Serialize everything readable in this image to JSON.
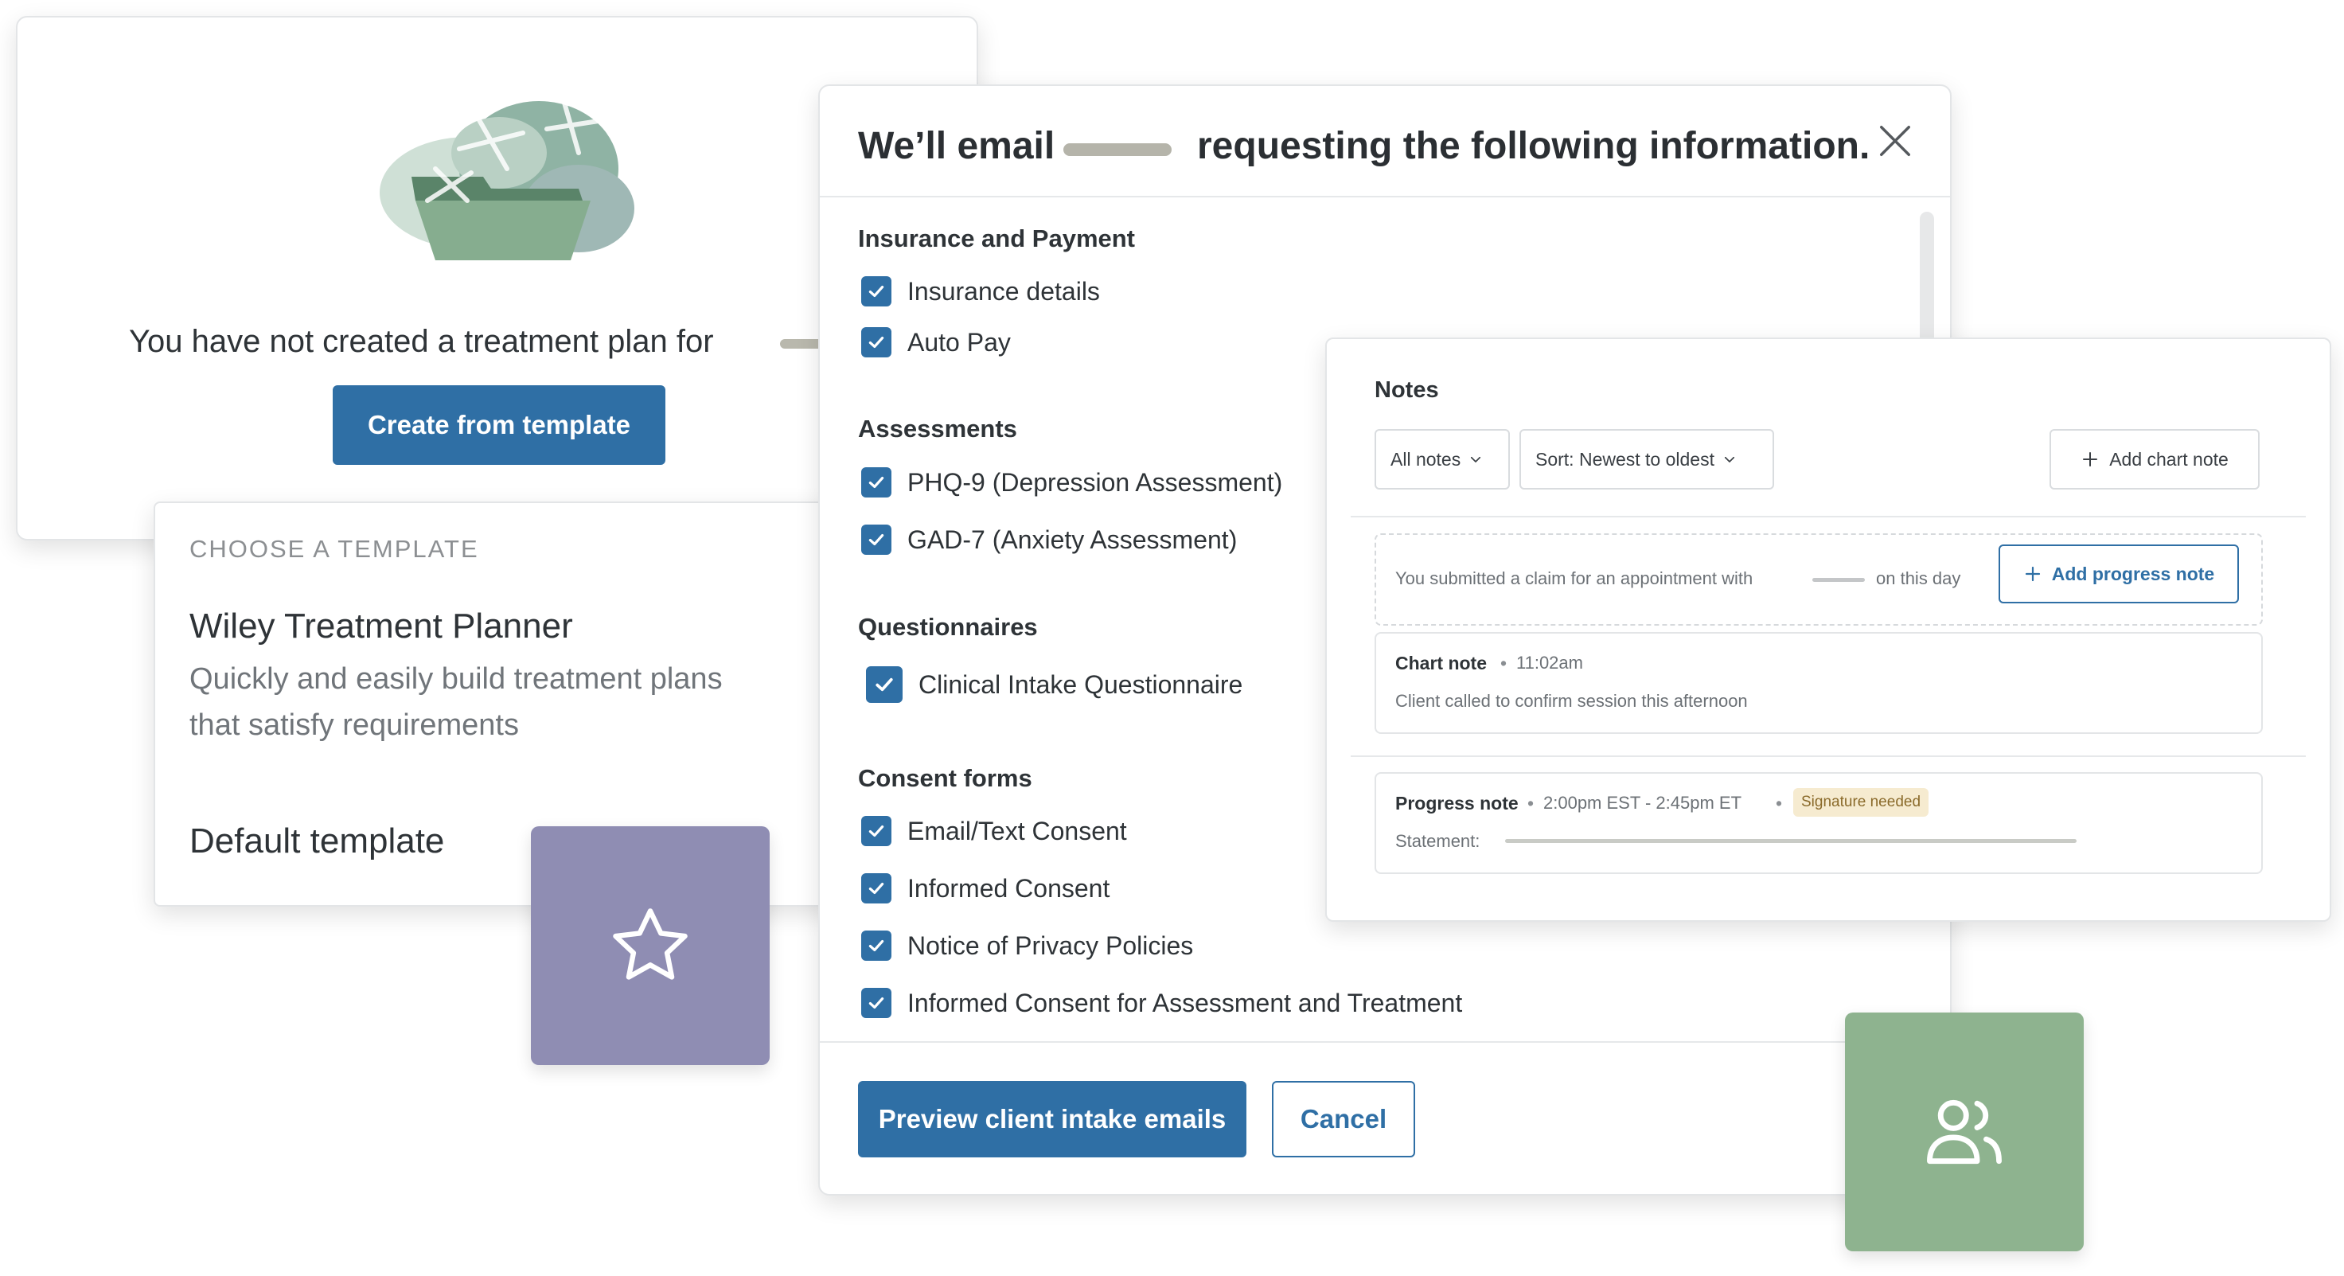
{
  "treatment_plan": {
    "message": "You have not created a treatment plan for",
    "create_button": "Create from template"
  },
  "template_picker": {
    "label": "CHOOSE A TEMPLATE",
    "title": "Wiley Treatment Planner",
    "description": "Quickly and easily build treatment plans that satisfy requirements",
    "default": "Default template"
  },
  "email_modal": {
    "title_prefix": "We’ll email",
    "title_suffix": "requesting the following information.",
    "sections": {
      "insurance": {
        "title": "Insurance and Payment",
        "items": [
          "Insurance details",
          "Auto Pay"
        ]
      },
      "assessments": {
        "title": "Assessments",
        "items": [
          "PHQ-9 (Depression Assessment)",
          "GAD-7 (Anxiety Assessment)"
        ]
      },
      "questionnaires": {
        "title": "Questionnaires",
        "items": [
          "Clinical Intake Questionnaire"
        ]
      },
      "consent": {
        "title": "Consent forms",
        "items": [
          "Email/Text Consent",
          "Informed Consent",
          "Notice of Privacy Policies",
          "Informed Consent for Assessment and Treatment"
        ]
      }
    },
    "preview_button": "Preview client intake emails",
    "cancel_button": "Cancel"
  },
  "notes": {
    "title": "Notes",
    "filter": "All notes",
    "sort": "Sort: Newest to oldest",
    "add_chart_note": "Add chart note",
    "claim_prefix": "You submitted a claim for an appointment with",
    "claim_suffix": "on this day",
    "add_progress_note": "Add progress note",
    "chart_note": {
      "label": "Chart note",
      "time": "11:02am",
      "body": "Client called to confirm session this afternoon"
    },
    "progress_note": {
      "label": "Progress note",
      "time": "2:00pm EST - 2:45pm ET",
      "badge": "Signature needed",
      "statement_label": "Statement:"
    }
  },
  "colors": {
    "primary": "#2f6fa5",
    "star_tile": "#8f8db3",
    "people_tile": "#8eb38f",
    "badge_bg": "#f6ebd0"
  },
  "icons": [
    "star-icon",
    "users-icon",
    "close-icon",
    "check-icon",
    "plus-icon",
    "chevron-down-icon"
  ]
}
